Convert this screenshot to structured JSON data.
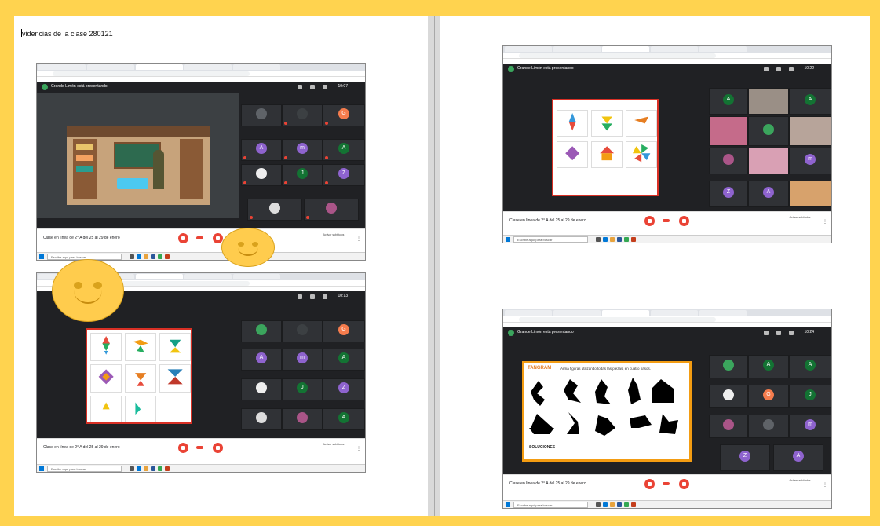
{
  "document": {
    "title": "videncias de la clase 280121"
  },
  "screenshots": [
    {
      "presenter": "Grande Limón está presentando",
      "clock": "10:07",
      "meeting_title": "Clase en línea de 2° A del 25 al 29 de enero",
      "captions": "Activar subtítulos",
      "taskbar_search": "Escribe aquí para buscar"
    },
    {
      "presenter": "",
      "clock": "10:13",
      "meeting_title": "Clase en línea de 2° A del 25 al 29 de enero",
      "captions": "Activar subtítulos",
      "taskbar_search": "Escribe aquí para buscar"
    },
    {
      "presenter": "Grande Limón está presentando",
      "clock": "10:22",
      "meeting_title": "Clase en línea de 2° A del 25 al 29 de enero",
      "captions": "Activar subtítulos",
      "taskbar_search": "Escribe aquí para buscar"
    },
    {
      "presenter": "Grande Limón está presentando",
      "clock": "10:24",
      "meeting_title": "Clase en línea de 2° A del 25 al 29 de enero",
      "captions": "Activar subtítulos",
      "taskbar_search": "Escribe aquí para buscar",
      "tangram_heading": "Arma figuras utilizando todas las piezas, en cuatro pasos.",
      "solutions_label": "SOLUCIONES"
    }
  ],
  "colors": {
    "frame": "#ffd34f",
    "meet_dark": "#202124",
    "end_call": "#ea4335",
    "smiley": "#ffcc4d"
  },
  "icons": [
    "smiley-face-icon",
    "smiley-face-icon"
  ]
}
